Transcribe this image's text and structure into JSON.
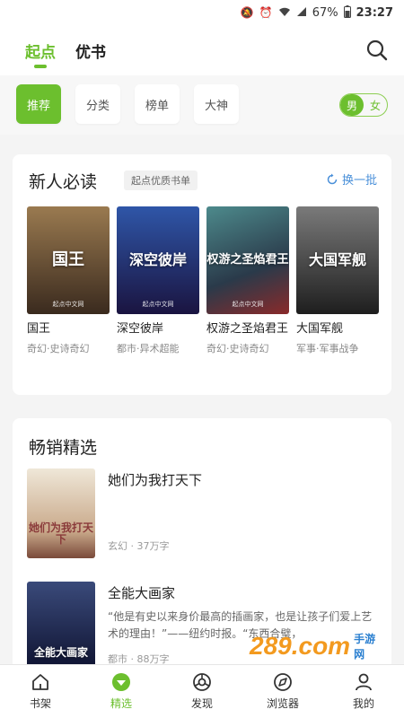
{
  "status_bar": {
    "battery": "67%",
    "time": "23:27"
  },
  "top_tabs": [
    {
      "label": "起点",
      "active": true
    },
    {
      "label": "优书",
      "active": false
    }
  ],
  "filters": [
    {
      "label": "推荐",
      "active": true
    },
    {
      "label": "分类",
      "active": false
    },
    {
      "label": "榜单",
      "active": false
    },
    {
      "label": "大神",
      "active": false
    }
  ],
  "gender": {
    "male": "男",
    "female": "女",
    "selected": "男"
  },
  "newbie": {
    "title": "新人必读",
    "tagline": "起点优质书单",
    "refresh_label": "换一批",
    "books": [
      {
        "cover_text": "国王",
        "title": "国王",
        "meta": "奇幻·史诗奇幻",
        "cover_pub": "起点中文网",
        "colors": [
          "#7a5a3a",
          "#2b2b2b"
        ]
      },
      {
        "cover_text": "深空彼岸",
        "title": "深空彼岸",
        "meta": "都市·异术超能",
        "cover_pub": "起点中文网",
        "colors": [
          "#2a3f8a",
          "#1a1440"
        ]
      },
      {
        "cover_text": "权游之圣焰君王",
        "title": "权游之圣焰君王",
        "meta": "奇幻·史诗奇幻",
        "cover_pub": "起点中文网",
        "colors": [
          "#3c6d70",
          "#8a2a2a"
        ]
      },
      {
        "cover_text": "大国军舰",
        "title": "大国军舰",
        "meta": "军事·军事战争",
        "cover_pub": "",
        "colors": [
          "#6a6a6a",
          "#1e1e1e"
        ]
      }
    ]
  },
  "bestsellers": {
    "title": "畅销精选",
    "items": [
      {
        "cover_text": "她们为我打天下",
        "title": "她们为我打天下",
        "desc": "",
        "meta": "玄幻 · 37万字",
        "colors": [
          "#e8e0d0",
          "#8a5a4a"
        ]
      },
      {
        "cover_text": "全能大画家",
        "title": "全能大画家",
        "desc": "“他是有史以来身价最高的插画家，也是让孩子们爱上艺术的理由！”——纽约时报。“东西合璧，",
        "meta": "都市 · 88万字",
        "colors": [
          "#3a4a7a",
          "#0e1230"
        ]
      }
    ]
  },
  "watermark": {
    "big": "289.com",
    "small": "手游网"
  },
  "bottom_nav": [
    {
      "label": "书架",
      "icon": "bookshelf-icon",
      "active": false
    },
    {
      "label": "精选",
      "icon": "featured-icon",
      "active": true
    },
    {
      "label": "发现",
      "icon": "discover-icon",
      "active": false
    },
    {
      "label": "浏览器",
      "icon": "browser-icon",
      "active": false
    },
    {
      "label": "我的",
      "icon": "profile-icon",
      "active": false
    }
  ],
  "colors": {
    "accent": "#6cbf2e",
    "link": "#4a90d9"
  }
}
